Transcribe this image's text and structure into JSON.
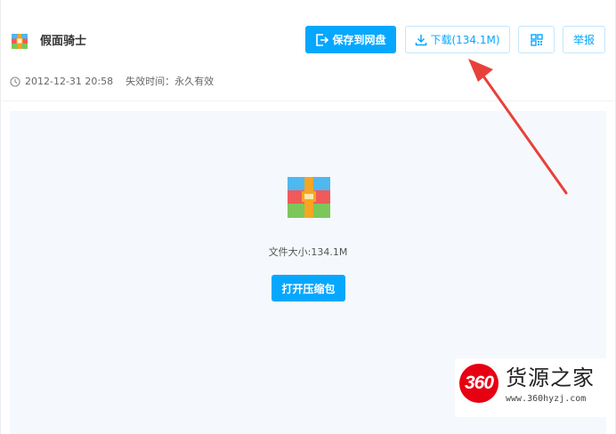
{
  "file": {
    "name": "假面骑士",
    "date": "2012-12-31 20:58",
    "expire": "失效时间：永久有效",
    "size_text": "文件大小:134.1M"
  },
  "toolbar": {
    "save_label": "保存到网盘",
    "download_label": "下载(134.1M)",
    "qr_icon": "qr-code-icon",
    "report_label": "举报"
  },
  "preview": {
    "open_label": "打开压缩包",
    "icon": "archive-icon"
  },
  "watermark": {
    "badge": "360",
    "title": "货源之家",
    "url": "www.360hyzj.com"
  },
  "colors": {
    "accent": "#06a7ff",
    "arrow": "#e8413a",
    "preview_bg": "#f5f8fc"
  }
}
